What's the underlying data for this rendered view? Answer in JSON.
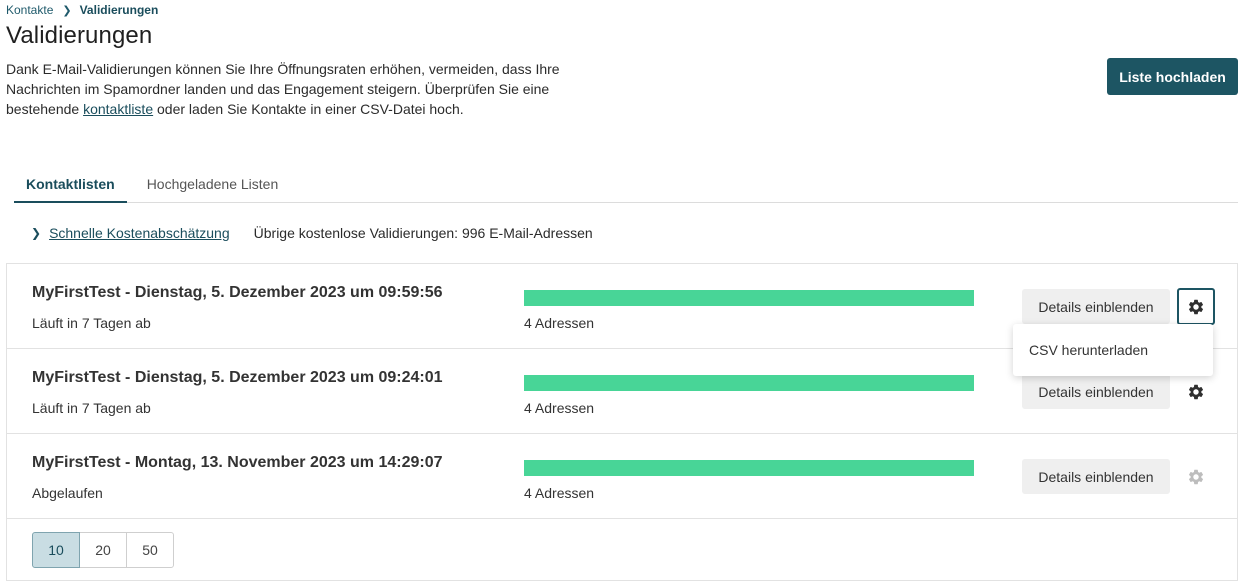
{
  "breadcrumb": {
    "parent": "Kontakte",
    "current": "Validierungen"
  },
  "page_title": "Validierungen",
  "intro": {
    "text_before": "Dank E-Mail-Validierungen können Sie Ihre Öffnungsraten erhöhen, vermeiden, dass Ihre Nachrichten im Spamordner landen und das Engagement steigern. Überprüfen Sie eine bestehende ",
    "link": "kontaktliste",
    "text_after": " oder laden Sie Kontakte in einer CSV-Datei hoch."
  },
  "upload_button": "Liste hochladen",
  "tabs": [
    {
      "label": "Kontaktlisten",
      "active": true
    },
    {
      "label": "Hochgeladene Listen",
      "active": false
    }
  ],
  "estimate": {
    "link": "Schnelle Kostenabschätzung",
    "remaining": "Übrige kostenlose Validierungen: 996 E-Mail-Adressen"
  },
  "rows": [
    {
      "title": "MyFirstTest - Dienstag, 5. Dezember 2023 um 09:59:56",
      "status": "Läuft in 7 Tagen ab",
      "count": "4 Adressen",
      "progress": 1.0,
      "details": "Details einblenden",
      "gear_state": "focused"
    },
    {
      "title": "MyFirstTest - Dienstag, 5. Dezember 2023 um 09:24:01",
      "status": "Läuft in 7 Tagen ab",
      "count": "4 Adressen",
      "progress": 1.0,
      "details": "Details einblenden",
      "gear_state": "normal"
    },
    {
      "title": "MyFirstTest - Montag, 13. November 2023 um 14:29:07",
      "status": "Abgelaufen",
      "count": "4 Adressen",
      "progress": 1.0,
      "details": "Details einblenden",
      "gear_state": "disabled"
    }
  ],
  "dropdown": {
    "item": "CSV herunterladen"
  },
  "pagination": {
    "options": [
      "10",
      "20",
      "50"
    ],
    "selected": "10"
  },
  "colors": {
    "accent": "#1d5563",
    "progress": "#48d597",
    "gear": "#2f2f2f",
    "gear_disabled": "#bdbdbd"
  }
}
